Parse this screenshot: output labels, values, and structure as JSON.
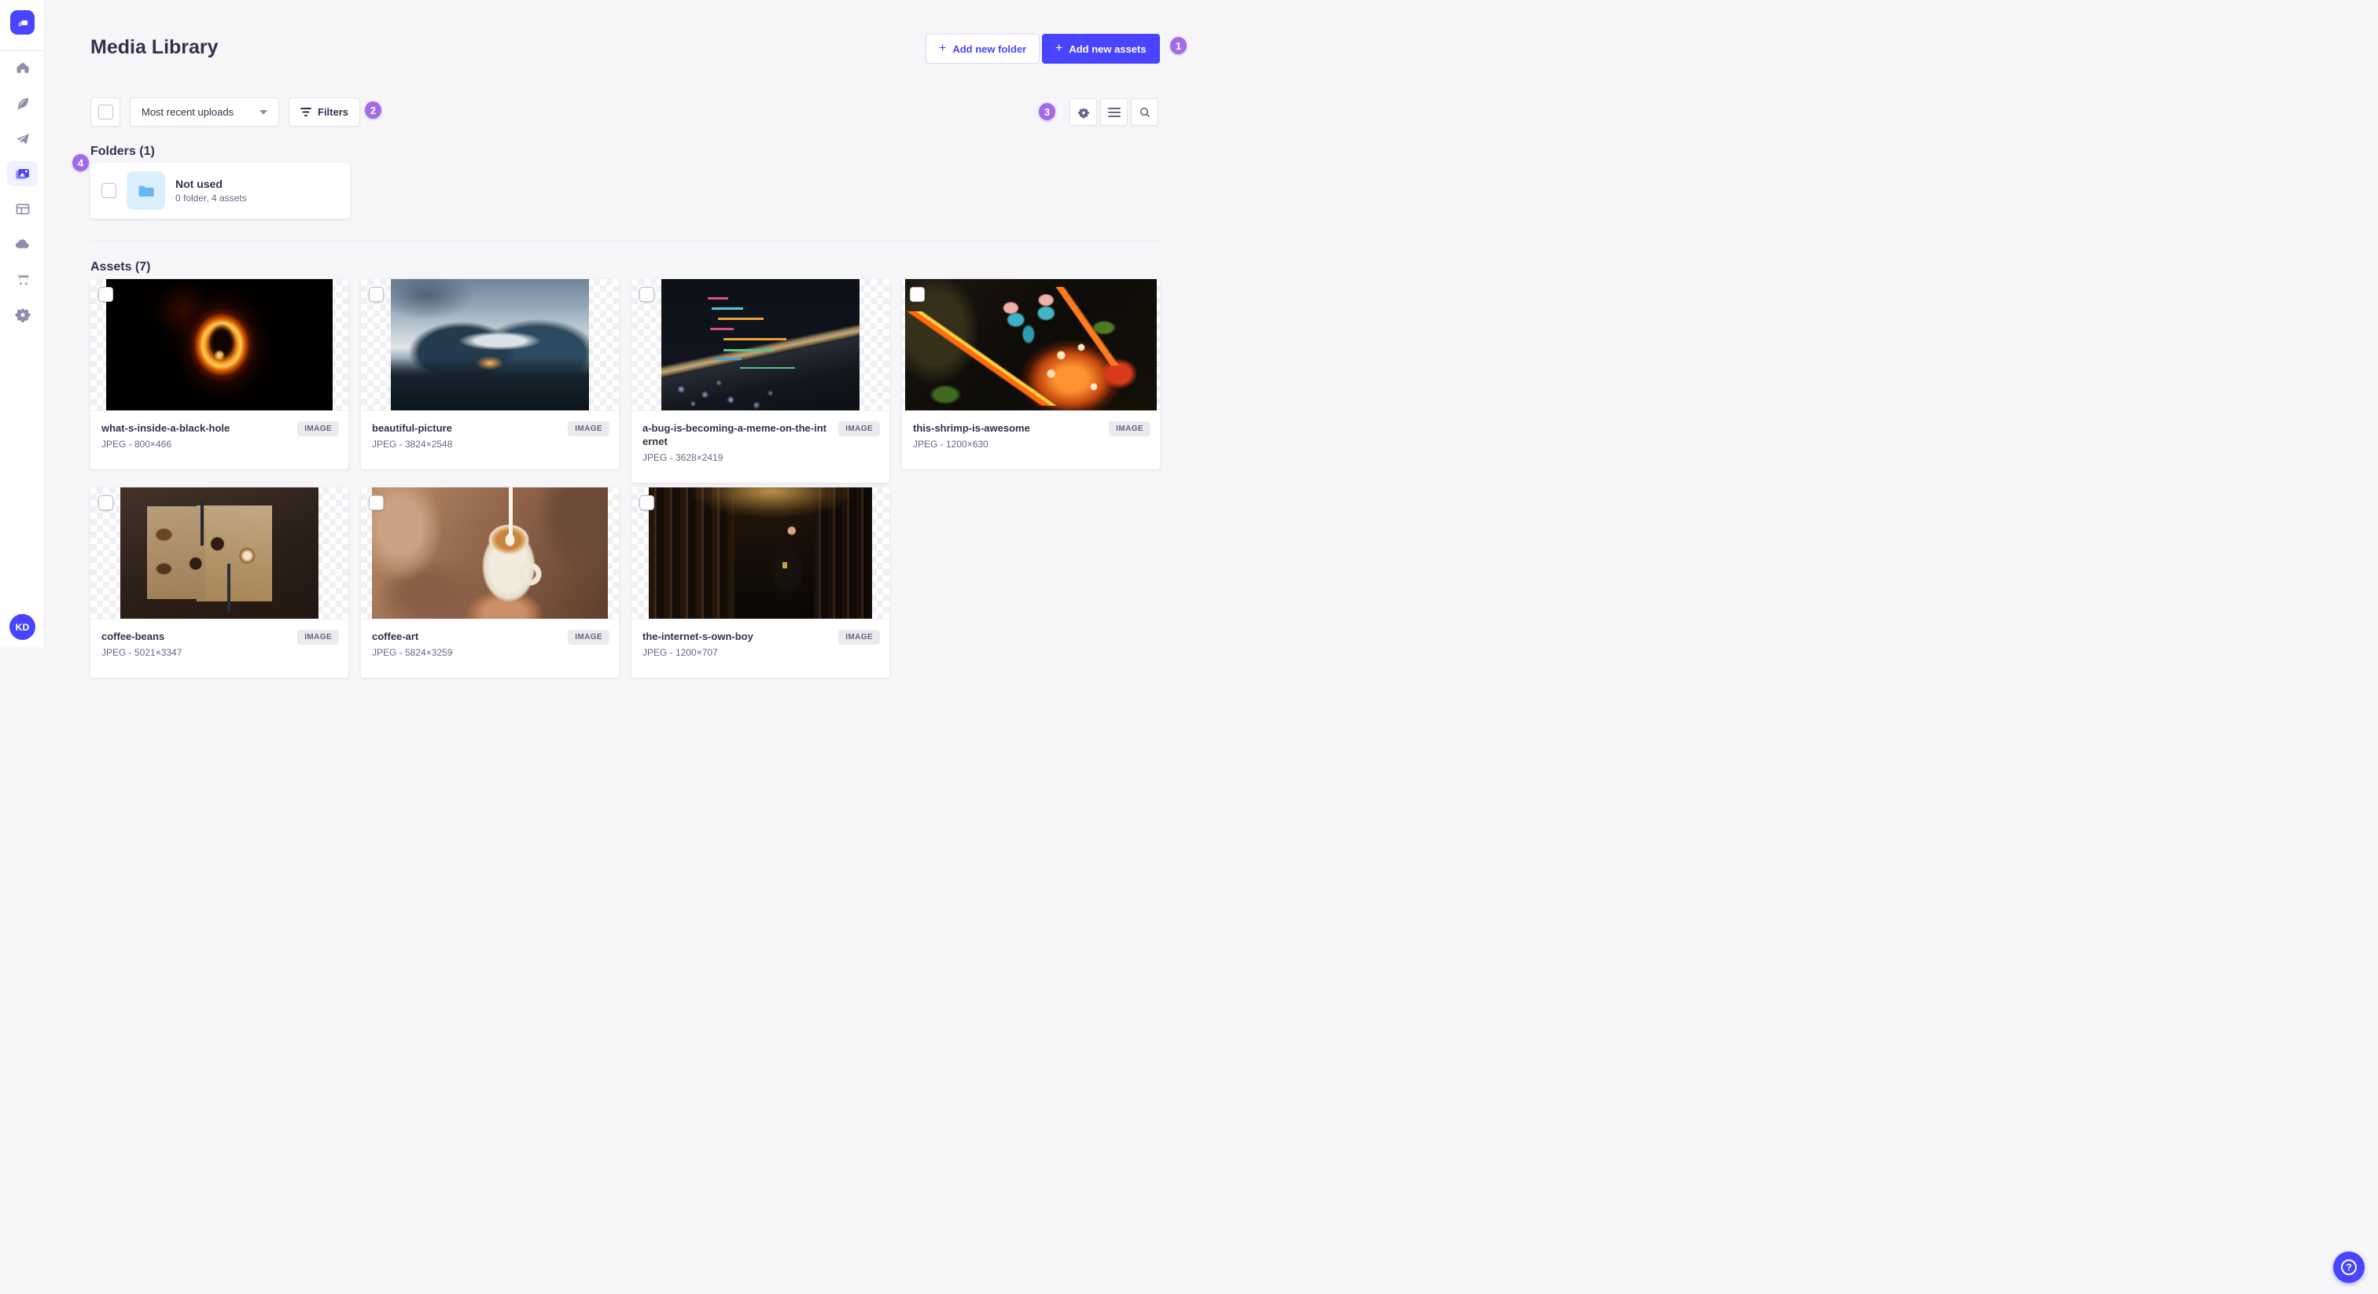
{
  "app": {
    "logo_icon": "strapi-logo"
  },
  "sidebar": {
    "items": [
      {
        "icon": "home-icon",
        "selected": false
      },
      {
        "icon": "feather-icon",
        "selected": false
      },
      {
        "icon": "paper-plane-icon",
        "selected": false
      },
      {
        "icon": "media-library-icon",
        "selected": true
      },
      {
        "icon": "layout-icon",
        "selected": false
      },
      {
        "icon": "cloud-icon",
        "selected": false
      },
      {
        "icon": "cart-icon",
        "selected": false
      },
      {
        "icon": "gear-icon",
        "selected": false
      }
    ],
    "avatar_initials": "KD"
  },
  "header": {
    "title": "Media Library",
    "add_folder_label": "Add new folder",
    "add_assets_label": "Add new assets",
    "plus": "+"
  },
  "toolbar": {
    "sort_value": "Most recent uploads",
    "filters_label": "Filters",
    "icons": [
      "settings-gear-icon",
      "list-view-icon",
      "search-icon"
    ]
  },
  "annotations": [
    "1",
    "2",
    "3",
    "4"
  ],
  "folders": {
    "heading": "Folders (1)",
    "cards": [
      {
        "name": "Not used",
        "meta": "0 folder, 4 assets"
      }
    ]
  },
  "assets": {
    "heading": "Assets (7)",
    "items": [
      {
        "name": "what-s-inside-a-black-hole",
        "meta": "JPEG - 800×466",
        "badge": "IMAGE"
      },
      {
        "name": "beautiful-picture",
        "meta": "JPEG - 3824×2548",
        "badge": "IMAGE"
      },
      {
        "name": "a-bug-is-becoming-a-meme-on-the-internet",
        "meta": "JPEG - 3628×2419",
        "badge": "IMAGE"
      },
      {
        "name": "this-shrimp-is-awesome",
        "meta": "JPEG - 1200×630",
        "badge": "IMAGE"
      },
      {
        "name": "coffee-beans",
        "meta": "JPEG - 5021×3347",
        "badge": "IMAGE"
      },
      {
        "name": "coffee-art",
        "meta": "JPEG - 5824×3259",
        "badge": "IMAGE"
      },
      {
        "name": "the-internet-s-own-boy",
        "meta": "JPEG - 1200×707",
        "badge": "IMAGE"
      }
    ]
  },
  "help": {
    "label": "?"
  },
  "colors": {
    "primary": "#4945ff",
    "primary_light_bg": "#f0f0ff",
    "annotation_badge": "#a36ae8",
    "folder_blue": "#66b7f1",
    "page_background": "#f6f6f9",
    "text_dark": "#32324d",
    "text_muted": "#666687"
  }
}
